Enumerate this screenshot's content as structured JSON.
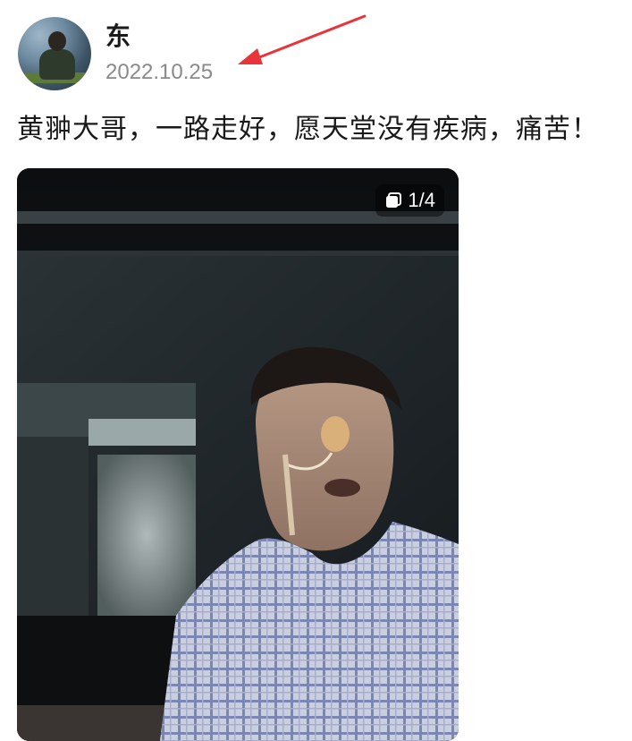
{
  "post": {
    "author": {
      "name": "东"
    },
    "date": "2022.10.25",
    "text": "黄翀大哥，一路走好，愿天堂没有疾病，痛苦！",
    "image": {
      "page_indicator": "1/4",
      "badge_icon": "image-stack-icon",
      "subject": "man-selfie-with-nasal-feeding-tube-icon"
    },
    "annotation": {
      "arrow_color": "#e8343b",
      "arrow_icon": "red-arrow-icon"
    }
  },
  "colors": {
    "text_primary": "#1a1a1a",
    "text_secondary": "#8a8a8a",
    "background": "#ffffff"
  }
}
